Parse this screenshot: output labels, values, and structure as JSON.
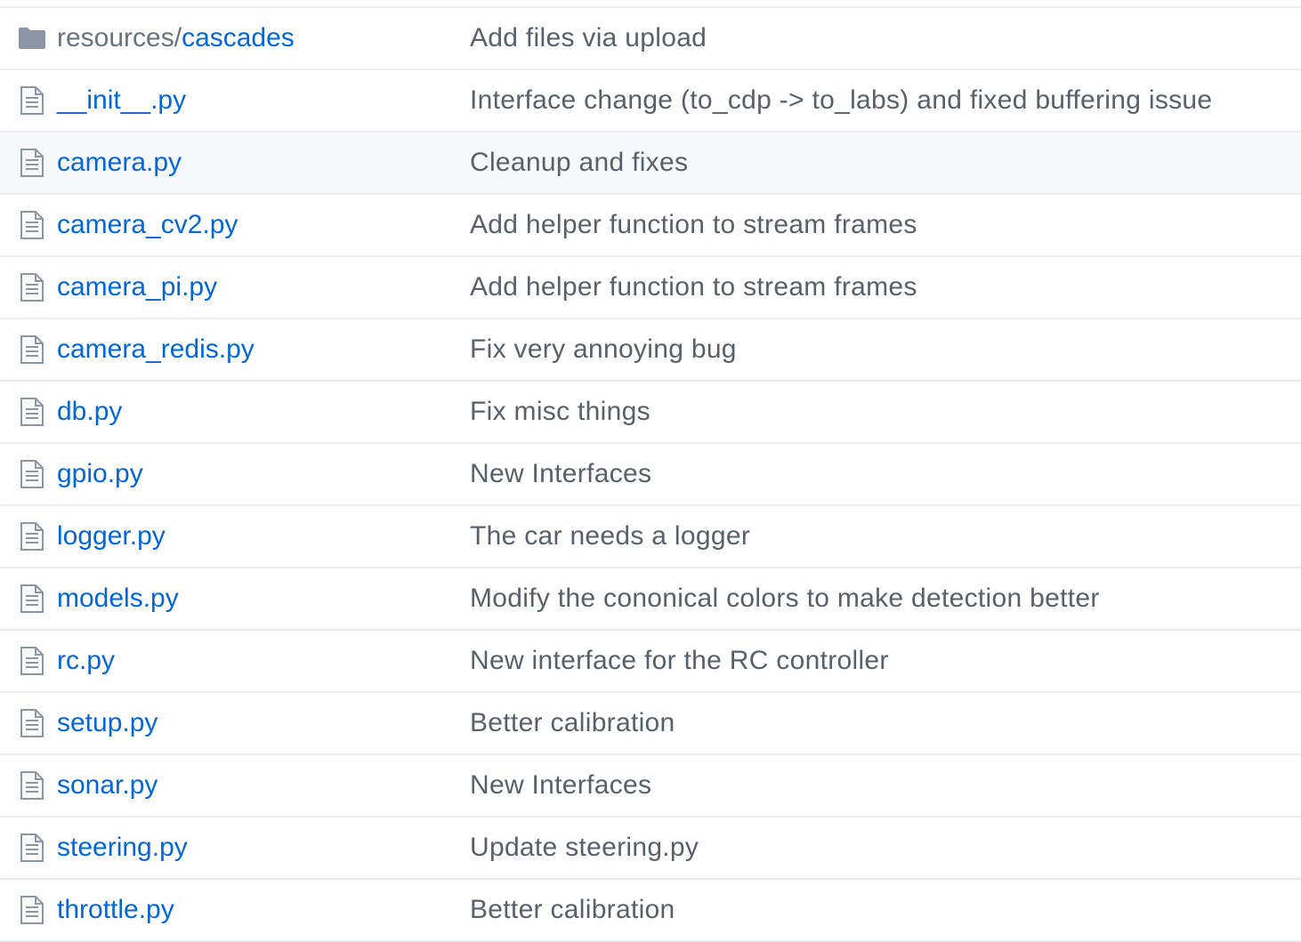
{
  "colors": {
    "link": "#0366d6",
    "message": "#586069",
    "icon": "#8b96a5",
    "border": "#eaecef",
    "hover_row": "#f6f8fa"
  },
  "files": [
    {
      "type": "folder",
      "icon": "folder-icon",
      "prefix": "resources/",
      "name": "cascades",
      "message": "Add files via upload"
    },
    {
      "type": "file",
      "icon": "file-icon",
      "prefix": "",
      "name": "__init__.py",
      "message": "Interface change (to_cdp -> to_labs) and fixed buffering issue"
    },
    {
      "type": "file",
      "icon": "file-icon",
      "prefix": "",
      "name": "camera.py",
      "message": "Cleanup and fixes"
    },
    {
      "type": "file",
      "icon": "file-icon",
      "prefix": "",
      "name": "camera_cv2.py",
      "message": "Add helper function to stream frames"
    },
    {
      "type": "file",
      "icon": "file-icon",
      "prefix": "",
      "name": "camera_pi.py",
      "message": "Add helper function to stream frames"
    },
    {
      "type": "file",
      "icon": "file-icon",
      "prefix": "",
      "name": "camera_redis.py",
      "message": "Fix very annoying bug"
    },
    {
      "type": "file",
      "icon": "file-icon",
      "prefix": "",
      "name": "db.py",
      "message": "Fix misc things"
    },
    {
      "type": "file",
      "icon": "file-icon",
      "prefix": "",
      "name": "gpio.py",
      "message": "New Interfaces"
    },
    {
      "type": "file",
      "icon": "file-icon",
      "prefix": "",
      "name": "logger.py",
      "message": "The car needs a logger"
    },
    {
      "type": "file",
      "icon": "file-icon",
      "prefix": "",
      "name": "models.py",
      "message": "Modify the cononical colors to make detection better"
    },
    {
      "type": "file",
      "icon": "file-icon",
      "prefix": "",
      "name": "rc.py",
      "message": "New interface for the RC controller"
    },
    {
      "type": "file",
      "icon": "file-icon",
      "prefix": "",
      "name": "setup.py",
      "message": "Better calibration"
    },
    {
      "type": "file",
      "icon": "file-icon",
      "prefix": "",
      "name": "sonar.py",
      "message": "New Interfaces"
    },
    {
      "type": "file",
      "icon": "file-icon",
      "prefix": "",
      "name": "steering.py",
      "message": "Update steering.py"
    },
    {
      "type": "file",
      "icon": "file-icon",
      "prefix": "",
      "name": "throttle.py",
      "message": "Better calibration"
    }
  ]
}
